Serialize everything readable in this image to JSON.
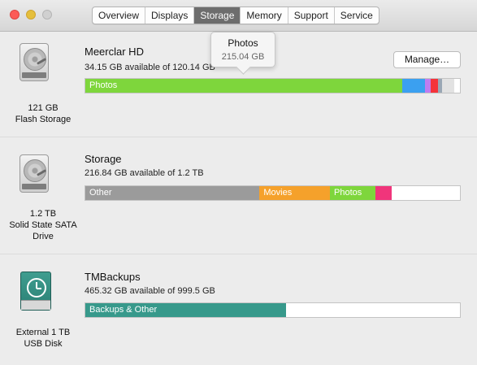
{
  "window": {
    "tabs": [
      "Overview",
      "Displays",
      "Storage",
      "Memory",
      "Support",
      "Service"
    ],
    "active_tab": "Storage"
  },
  "disks": [
    {
      "name": "Meerclar HD",
      "available": "34.15 GB available of 120.14 GB",
      "caption_line1": "121 GB",
      "caption_line2": "Flash Storage",
      "manage_label": "Manage…",
      "segments": [
        {
          "label": "Photos",
          "color": "#7ed63c",
          "fraction": 0.845
        },
        {
          "label": "",
          "color": "#3ba0f0",
          "fraction": 0.062
        },
        {
          "label": "",
          "color": "#c07cf0",
          "fraction": 0.016
        },
        {
          "label": "",
          "color": "#f5333a",
          "fraction": 0.018
        },
        {
          "label": "",
          "color": "#9aa7b5",
          "fraction": 0.012
        },
        {
          "label": "",
          "color": "#e2e2e2",
          "fraction": 0.031
        }
      ]
    },
    {
      "name": "Storage",
      "available": "216.84 GB available of 1.2 TB",
      "caption_line1": "1.2 TB",
      "caption_line2": "Solid State SATA",
      "caption_line3": "Drive",
      "segments": [
        {
          "label": "Other",
          "color": "#9b9b9b",
          "fraction": 0.465
        },
        {
          "label": "Movies",
          "color": "#f5a12b",
          "fraction": 0.188
        },
        {
          "label": "Photos",
          "color": "#7ed63c",
          "fraction": 0.122
        },
        {
          "label": "",
          "color": "#f0357b",
          "fraction": 0.042
        }
      ]
    },
    {
      "name": "TMBackups",
      "available": "465.32 GB available of 999.5 GB",
      "caption_line1": "External 1 TB",
      "caption_line2": "USB Disk",
      "segments": [
        {
          "label": "Backups & Other",
          "color": "#37998b",
          "fraction": 0.535
        }
      ]
    }
  ],
  "tooltip": {
    "title": "Photos",
    "value": "215.04 GB"
  }
}
